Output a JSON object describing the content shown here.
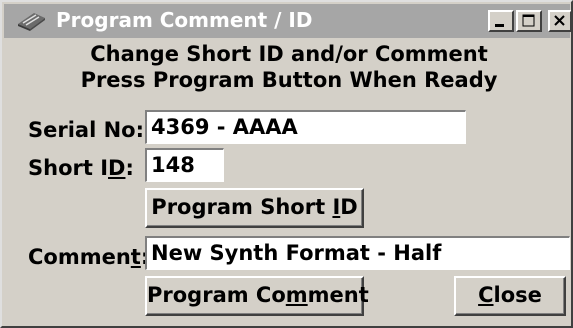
{
  "window": {
    "title": "Program Comment / ID",
    "buttons": {
      "minimize_icon": "minimize-icon",
      "maximize_icon": "maximize-icon",
      "close_icon": "close-icon"
    }
  },
  "header": {
    "line1": "Change Short ID and/or Comment",
    "line2": "Press Program Button When Ready"
  },
  "serial": {
    "label": "Serial No:",
    "value": "4369 - AAAA"
  },
  "short_id": {
    "label_pre": "Short I",
    "label_mnemonic": "D",
    "label_post": ":",
    "value": "148"
  },
  "program_short_id_button": {
    "pre": "Program Short ",
    "mnemonic": "I",
    "post": "D"
  },
  "comment": {
    "label_pre": "Commen",
    "label_mnemonic": "t",
    "label_post": ":",
    "value": "New Synth Format - Half"
  },
  "program_comment_button": {
    "pre": "Program Co",
    "mnemonic": "m",
    "post": "ment"
  },
  "close_button": {
    "pre": "",
    "mnemonic": "C",
    "post": "lose"
  },
  "colors": {
    "face": "#d4d0c8",
    "titlebar_inactive": "#a6a6a6"
  }
}
